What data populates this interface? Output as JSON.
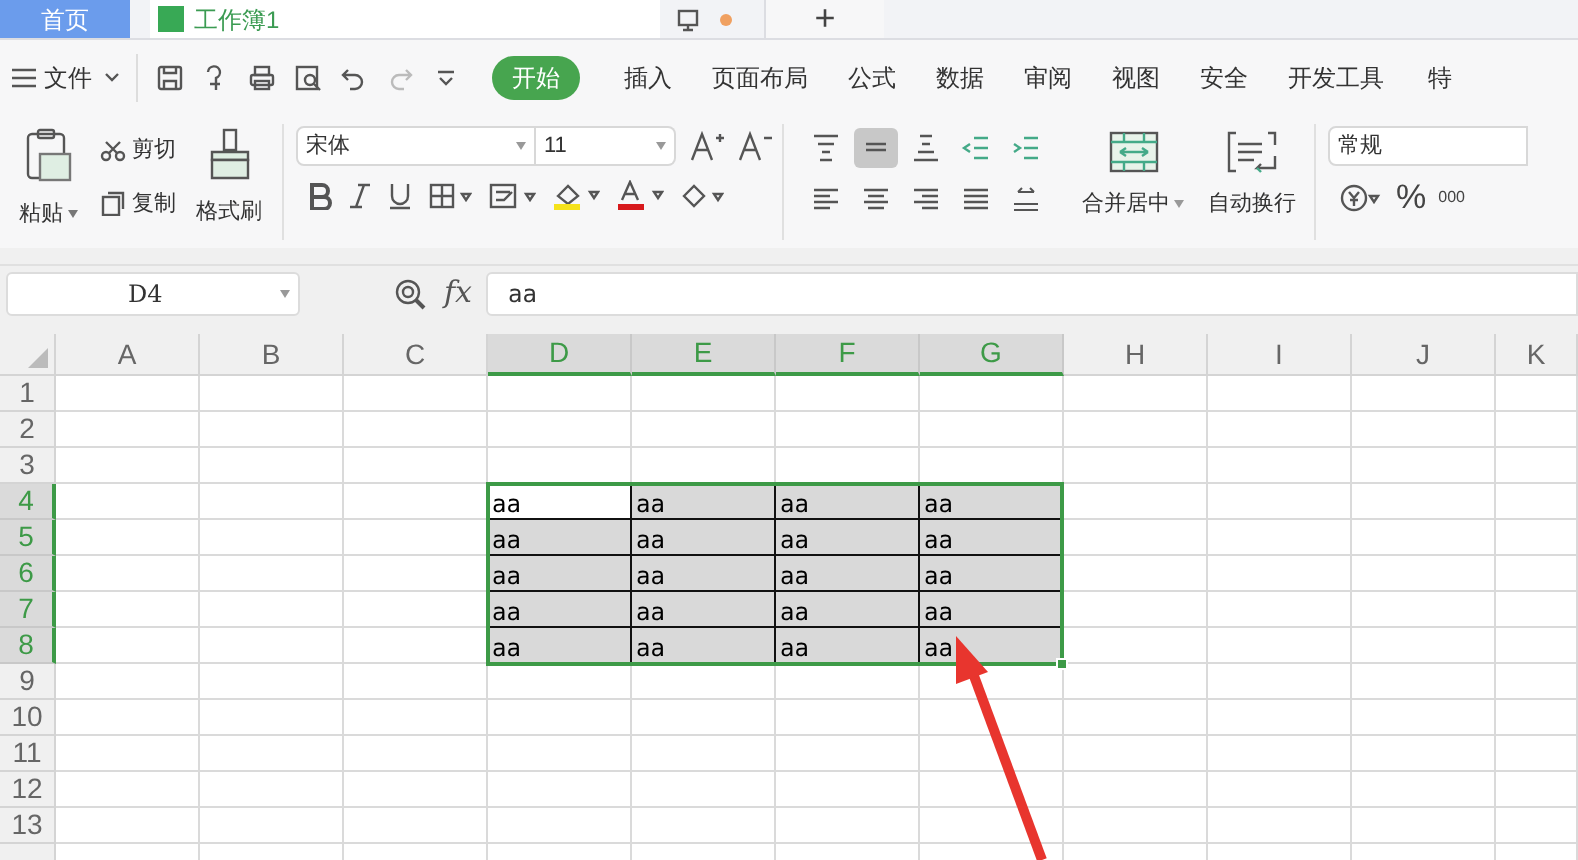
{
  "tabs": [
    {
      "label": "首页",
      "kind": "home",
      "selected": false
    },
    {
      "label": "工作簿1",
      "kind": "sheet",
      "selected": true
    }
  ],
  "new_tab": "+",
  "menu": {
    "file": "文件",
    "ribbon_tabs": [
      {
        "label": "开始",
        "selected": true
      },
      {
        "label": "插入",
        "selected": false
      },
      {
        "label": "页面布局",
        "selected": false
      },
      {
        "label": "公式",
        "selected": false
      },
      {
        "label": "数据",
        "selected": false
      },
      {
        "label": "审阅",
        "selected": false
      },
      {
        "label": "视图",
        "selected": false
      },
      {
        "label": "安全",
        "selected": false
      },
      {
        "label": "开发工具",
        "selected": false
      },
      {
        "label": "特",
        "selected": false
      }
    ]
  },
  "clipboard": {
    "paste": "粘贴",
    "cut": "剪切",
    "copy": "复制",
    "format_painter": "格式刷"
  },
  "font": {
    "name": "宋体",
    "size": "11"
  },
  "alignment": [
    {
      "kind": "top",
      "selected": false
    },
    {
      "kind": "middle",
      "selected": true
    },
    {
      "kind": "bottom",
      "selected": false
    },
    {
      "kind": "outdent",
      "selected": false
    },
    {
      "kind": "indent",
      "selected": false
    },
    {
      "kind": "left",
      "selected": false
    },
    {
      "kind": "center",
      "selected": false
    },
    {
      "kind": "right",
      "selected": false
    },
    {
      "kind": "justify",
      "selected": false
    },
    {
      "kind": "distributed",
      "selected": false
    }
  ],
  "merge": "合并居中",
  "wrap": "自动换行",
  "number": {
    "format": "常规",
    "percent": "%",
    "thousands": "000"
  },
  "formula_bar": {
    "name_box": "D4",
    "fx": "fx",
    "value": "aa"
  },
  "sheet": {
    "columns": [
      {
        "label": "A",
        "selected": false
      },
      {
        "label": "B",
        "selected": false
      },
      {
        "label": "C",
        "selected": false
      },
      {
        "label": "D",
        "selected": true
      },
      {
        "label": "E",
        "selected": true
      },
      {
        "label": "F",
        "selected": true
      },
      {
        "label": "G",
        "selected": true
      },
      {
        "label": "H",
        "selected": false
      },
      {
        "label": "I",
        "selected": false
      },
      {
        "label": "J",
        "selected": false
      },
      {
        "label": "K",
        "selected": false
      }
    ],
    "rows": [
      {
        "label": "1",
        "selected": false
      },
      {
        "label": "2",
        "selected": false
      },
      {
        "label": "3",
        "selected": false
      },
      {
        "label": "4",
        "selected": true,
        "cells": [
          {
            "value": "aa",
            "active": true
          },
          {
            "value": "aa",
            "active": false
          },
          {
            "value": "aa",
            "active": false
          },
          {
            "value": "aa",
            "active": false
          }
        ]
      },
      {
        "label": "5",
        "selected": true,
        "cells": [
          {
            "value": "aa",
            "active": false
          },
          {
            "value": "aa",
            "active": false
          },
          {
            "value": "aa",
            "active": false
          },
          {
            "value": "aa",
            "active": false
          }
        ]
      },
      {
        "label": "6",
        "selected": true,
        "cells": [
          {
            "value": "aa",
            "active": false
          },
          {
            "value": "aa",
            "active": false
          },
          {
            "value": "aa",
            "active": false
          },
          {
            "value": "aa",
            "active": false
          }
        ]
      },
      {
        "label": "7",
        "selected": true,
        "cells": [
          {
            "value": "aa",
            "active": false
          },
          {
            "value": "aa",
            "active": false
          },
          {
            "value": "aa",
            "active": false
          },
          {
            "value": "aa",
            "active": false
          }
        ]
      },
      {
        "label": "8",
        "selected": true,
        "cells": [
          {
            "value": "aa",
            "active": false
          },
          {
            "value": "aa",
            "active": false
          },
          {
            "value": "aa",
            "active": false
          },
          {
            "value": "aa",
            "active": false
          }
        ]
      },
      {
        "label": "9",
        "selected": false
      },
      {
        "label": "10",
        "selected": false
      },
      {
        "label": "11",
        "selected": false
      },
      {
        "label": "12",
        "selected": false
      },
      {
        "label": "13",
        "selected": false
      }
    ]
  }
}
